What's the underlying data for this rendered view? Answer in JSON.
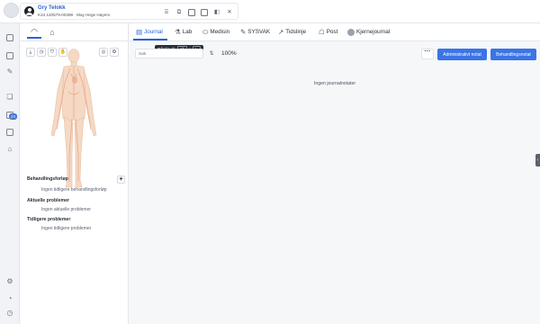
{
  "patient": {
    "name": "Gry Telokk",
    "meta": "K44 120579-00499 · May Hege Høyem"
  },
  "header_icons": [
    "calc-icon",
    "copy-icon",
    "calendar-icon",
    "document-icon",
    "split-icon",
    "close-icon"
  ],
  "rail_icons": [
    "inbox-icon",
    "document-icon",
    "edit-icon",
    "messages-icon",
    "calendar-icon",
    "wallet-icon",
    "home-icon",
    "gear-icon",
    "bell-icon",
    "clock-icon"
  ],
  "messages_badge": "20",
  "left_panel": {
    "sections": [
      {
        "title": "Behandlingsforløp",
        "empty": "Ingen tidligere behandlingsforløp"
      },
      {
        "title": "Aktuelle problemer",
        "empty": "Ingen aktuelle problemer"
      },
      {
        "title": "Tidligere problemer",
        "empty": "Ingen tidligere problemer"
      }
    ],
    "add_label": "+"
  },
  "tabs": {
    "journal": "Journal",
    "lab": "Lab",
    "medisin": "Medisin",
    "sysvak": "SYSVAK",
    "tidslinje": "Tidslinje",
    "post": "Post",
    "kjernejournal": "Kjernejournal"
  },
  "tooltip": {
    "text": "Gå til Lab",
    "key1": "Alt",
    "plus": "+",
    "key2": "L"
  },
  "toolbar": {
    "search_placeholder": "Søk",
    "zoom": "100%",
    "more": "···",
    "admin_button": "Administrativt notat",
    "treatment_button": "Behandlingsnotat"
  },
  "empty_message": "Ingen journalnotater",
  "colors": {
    "accent": "#2a63d6",
    "primary_button": "#3b74e6",
    "body_skin": "#f5d9c4",
    "body_organs": "#e8a887"
  }
}
